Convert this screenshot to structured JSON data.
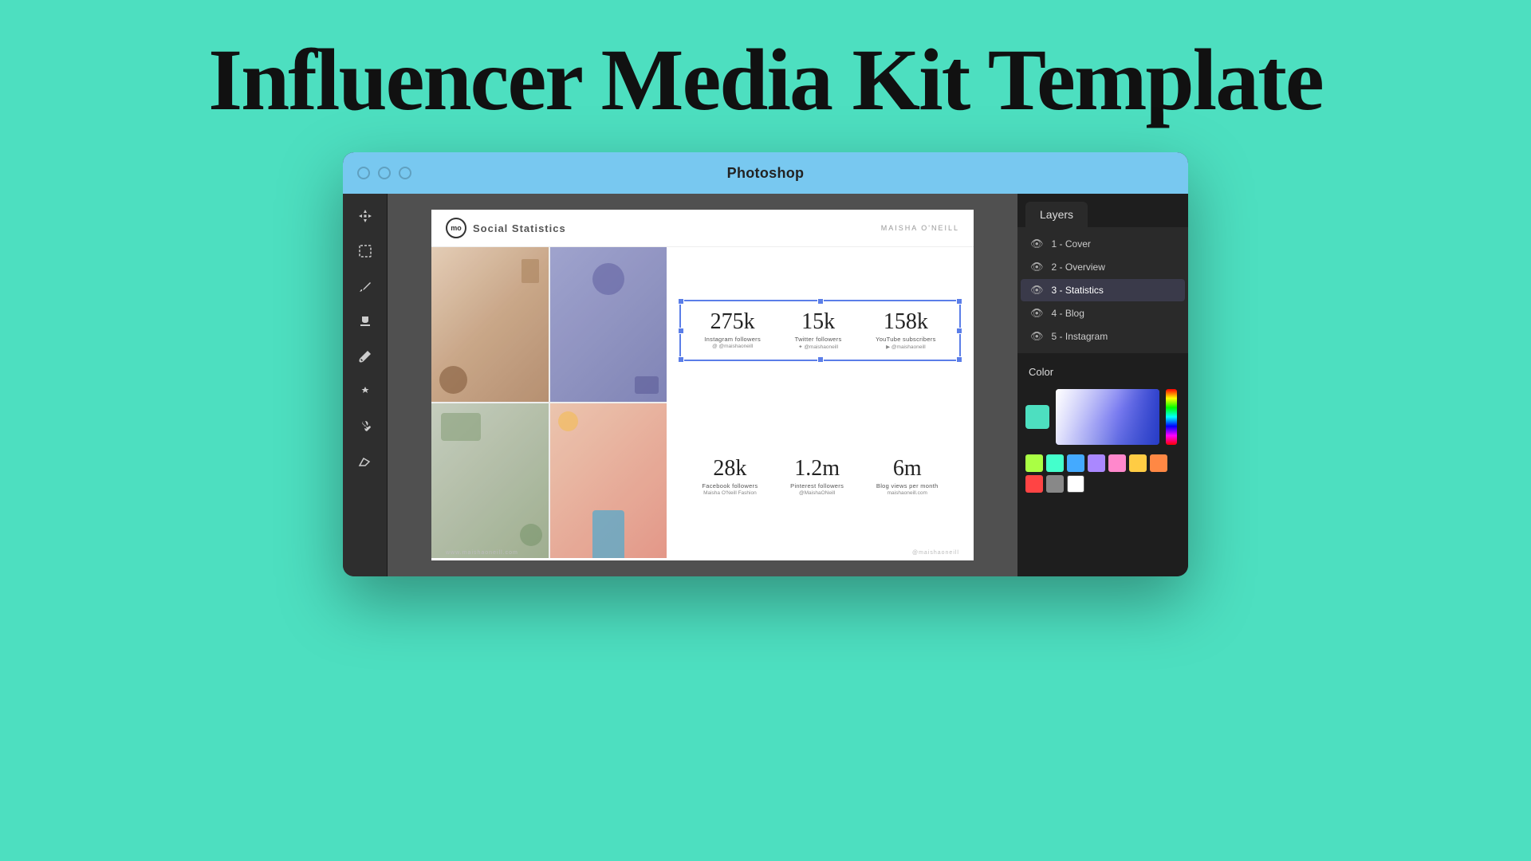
{
  "page": {
    "background_color": "#4DDFC0",
    "title": "Influencer Media Kit Template"
  },
  "app_window": {
    "title": "Photoshop",
    "title_bar_color": "#78c8f0",
    "window_dots": [
      "dot1",
      "dot2",
      "dot3"
    ]
  },
  "toolbar": {
    "tools": [
      {
        "name": "move",
        "icon": "✦",
        "label": "move-tool"
      },
      {
        "name": "marquee",
        "icon": "▭",
        "label": "marquee-tool"
      },
      {
        "name": "eyedropper",
        "icon": "✒",
        "label": "eyedropper-tool"
      },
      {
        "name": "stamp",
        "icon": "⬛",
        "label": "stamp-tool"
      },
      {
        "name": "brush",
        "icon": "✏",
        "label": "brush-tool"
      },
      {
        "name": "gradient",
        "icon": "◆",
        "label": "gradient-tool"
      },
      {
        "name": "pen",
        "icon": "✒",
        "label": "pen-tool"
      },
      {
        "name": "eraser",
        "icon": "⬜",
        "label": "eraser-tool"
      }
    ]
  },
  "document": {
    "logo_text": "mo",
    "page_title": "Social Statistics",
    "author": "MAISHA O'NEILL",
    "footer_left": "www.maishaoneill.com",
    "footer_right": "@maishaoneill",
    "stats_row1": [
      {
        "number": "275k",
        "label": "Instagram followers",
        "handle": "@ @maishaoneill"
      },
      {
        "number": "15k",
        "label": "Twitter followers",
        "handle": "✦ @maishaoneill"
      },
      {
        "number": "158k",
        "label": "YouTube subscribers",
        "handle": "▶ @maishaoneill"
      }
    ],
    "stats_row2": [
      {
        "number": "28k",
        "label": "Facebook followers",
        "handle": "Maisha O'Neill Fashion"
      },
      {
        "number": "1.2m",
        "label": "Pinterest followers",
        "handle": "@MaishaONeill"
      },
      {
        "number": "6m",
        "label": "Blog views per month",
        "handle": "maishaoneill.com"
      }
    ]
  },
  "layers": {
    "panel_label": "Layers",
    "items": [
      {
        "id": 1,
        "name": "1 - Cover",
        "active": false
      },
      {
        "id": 2,
        "name": "2 - Overview",
        "active": false
      },
      {
        "id": 3,
        "name": "3 - Statistics",
        "active": true
      },
      {
        "id": 4,
        "name": "4 - Blog",
        "active": false
      },
      {
        "id": 5,
        "name": "5 - Instagram",
        "active": false
      }
    ]
  },
  "color_panel": {
    "label": "Color",
    "swatches": [
      "#aaff44",
      "#44ffcc",
      "#44aaff",
      "#aa88ff",
      "#ff88cc",
      "#ffcc44",
      "#ff8844",
      "#ff4444",
      "#888888",
      "#ffffff"
    ]
  }
}
